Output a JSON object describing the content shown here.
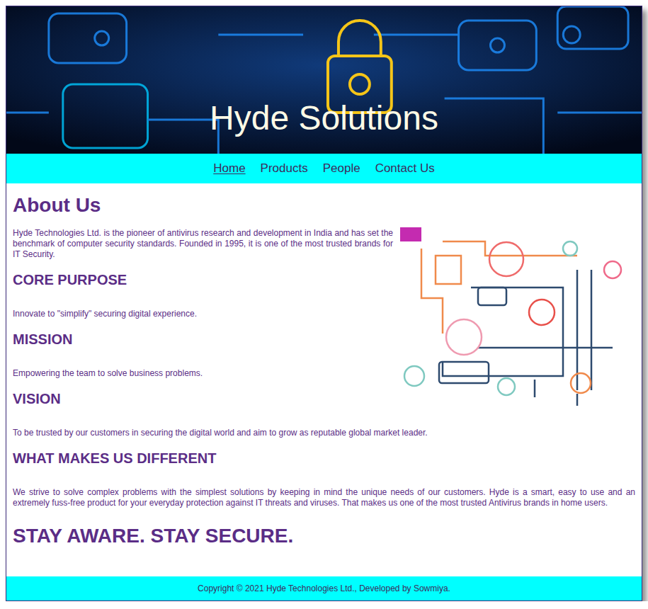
{
  "header": {
    "title": "Hyde Solutions"
  },
  "nav": [
    {
      "label": "Home",
      "selected": true
    },
    {
      "label": "Products",
      "selected": false
    },
    {
      "label": "People",
      "selected": false
    },
    {
      "label": "Contact Us",
      "selected": false
    }
  ],
  "about": {
    "title": "About Us",
    "intro": "Hyde Technologies Ltd. is the pioneer of antivirus research and development in India and has set the benchmark of computer security standards. Founded in 1995, it is one of the most trusted brands for IT Security.",
    "sections": [
      {
        "heading": "CORE PURPOSE",
        "body": "Innovate to \"simplify\" securing digital experience."
      },
      {
        "heading": "MISSION",
        "body": "Empowering the team to solve business problems."
      },
      {
        "heading": "VISION",
        "body": "To be trusted by our customers in securing the digital world and aim to grow as reputable global market leader."
      },
      {
        "heading": "WHAT MAKES US DIFFERENT",
        "body": "We strive to solve complex problems with the simplest solutions by keeping in mind the unique needs of our customers. Hyde is a smart, easy to use and an extremely fuss-free product for your everyday protection against IT threats and viruses. That makes us one of the most trusted Antivirus brands in home users."
      }
    ],
    "tagline": "STAY AWARE. STAY SECURE."
  },
  "footer": {
    "text": "Copyright © 2021 Hyde Technologies Ltd., Developed by Sowmiya."
  }
}
